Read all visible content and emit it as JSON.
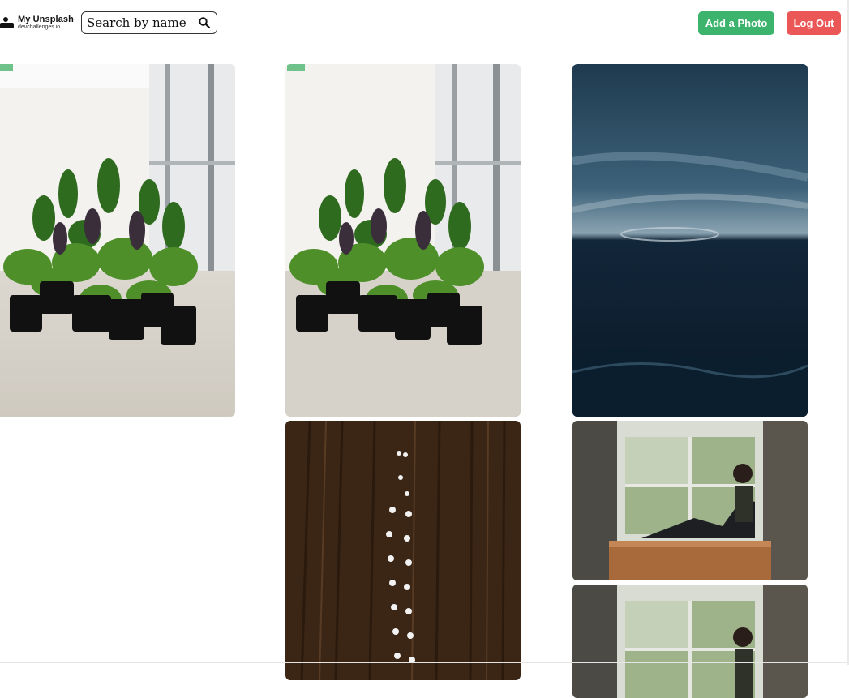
{
  "app": {
    "logo_title": "My Unsplash",
    "logo_subtitle": "devchallenges.io"
  },
  "search": {
    "placeholder": "Search by name"
  },
  "actions": {
    "add_photo_label": "Add a Photo",
    "logout_label": "Log Out"
  },
  "colors": {
    "add_button": "#3db46d",
    "logout_button": "#eb5757"
  },
  "gallery": {
    "photos": [
      {
        "subject": "potted plants by window"
      },
      {
        "subject": "potted plants by window"
      },
      {
        "subject": "dark ocean and sky"
      },
      {
        "subject": "aerial view of brown field with people"
      },
      {
        "subject": "woman sitting on windowsill"
      },
      {
        "subject": "woman sitting on windowsill"
      }
    ]
  }
}
